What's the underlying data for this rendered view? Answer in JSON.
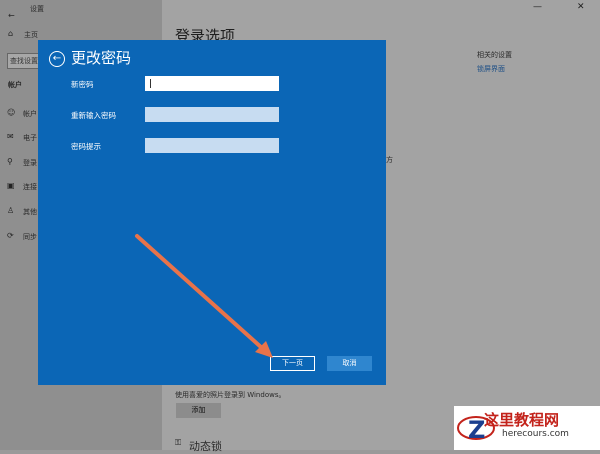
{
  "background": {
    "app_title": "设置",
    "nav_home": "主页",
    "search_placeholder": "查找设置",
    "section": "帐户",
    "side_items": [
      "帐户",
      "电子",
      "登录",
      "连接",
      "其他",
      "同步"
    ],
    "page_title": "登录选项",
    "related_title": "相关的设置",
    "related_link": "锁屏界面",
    "partial_text": "方",
    "picture_text": "使用喜爱的照片登录到 Windows。",
    "add_button": "添加",
    "bottom_partial": "动态锁"
  },
  "dialog": {
    "title": "更改密码",
    "fields": [
      {
        "label": "新密码",
        "value": ""
      },
      {
        "label": "重新输入密码",
        "value": ""
      },
      {
        "label": "密码提示",
        "value": ""
      }
    ],
    "next_button": "下一页",
    "cancel_button": "取消"
  },
  "watermark": {
    "cn": "这里教程网",
    "en": "herecours.com"
  },
  "colors": {
    "dialog_bg": "#0b66b6",
    "annotation_arrow": "#e8734a",
    "watermark_red": "#c3231b"
  }
}
